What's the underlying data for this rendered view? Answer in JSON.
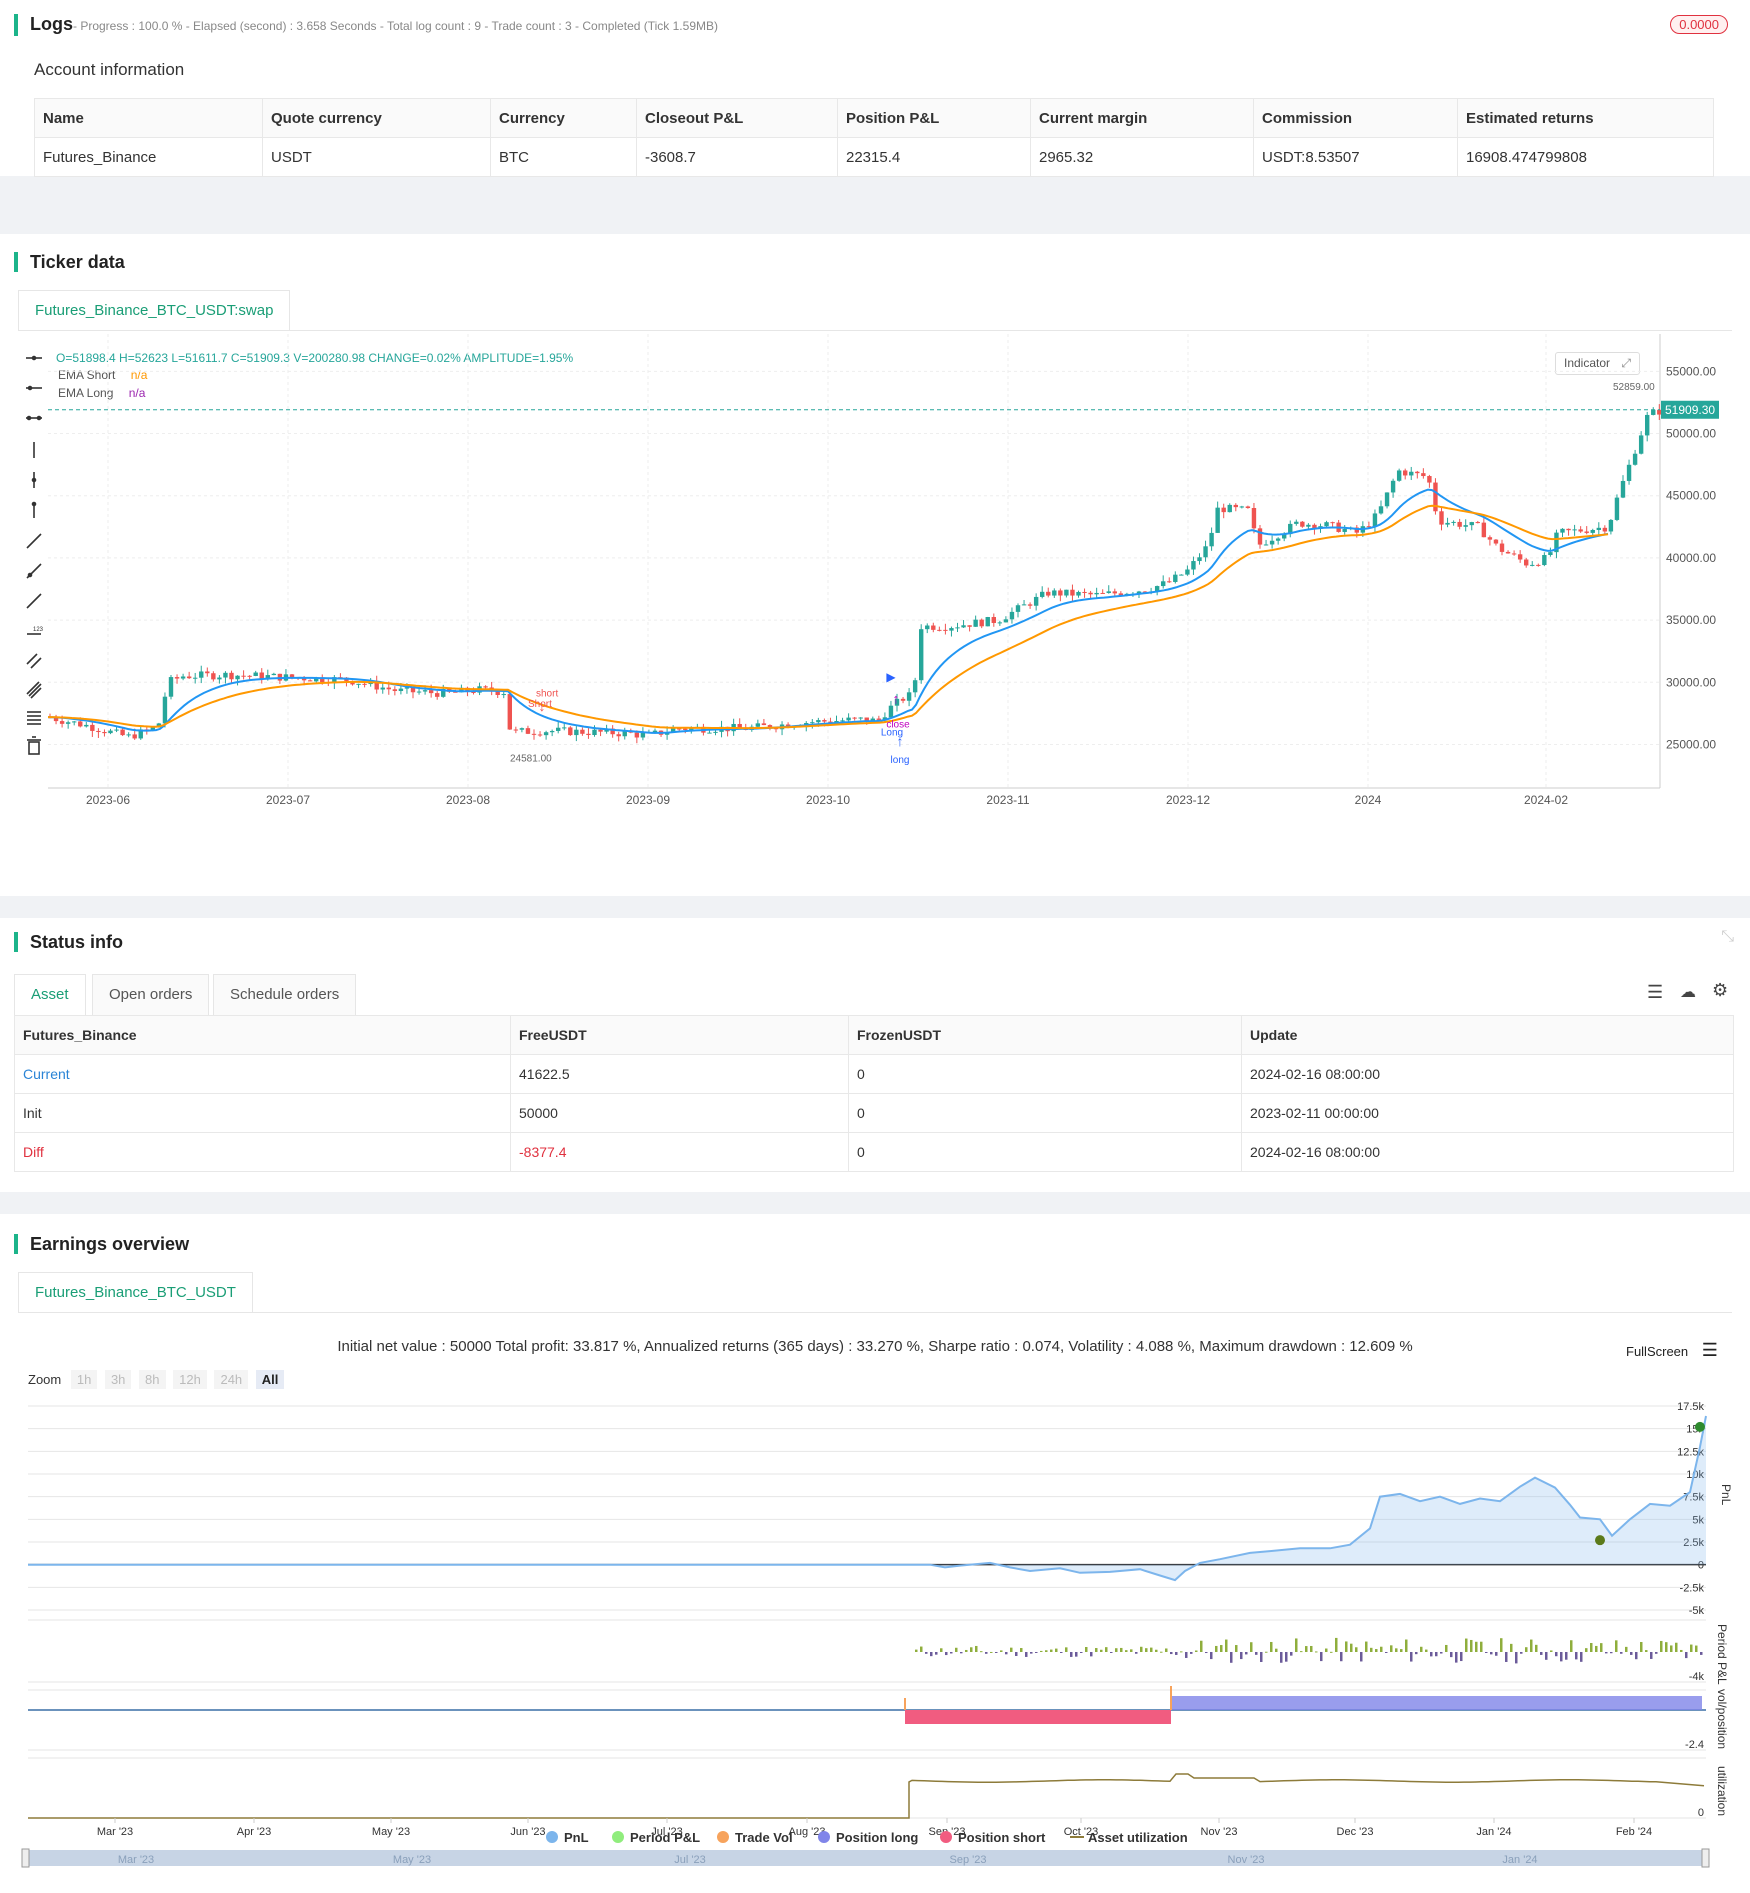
{
  "logs": {
    "title": "Logs",
    "progress_text": "- Progress : 100.0 % - Elapsed (second) : 3.658  Seconds - Total log count : 9 - Trade count : 3 - Completed (Tick 1.59MB)",
    "badge": "0.0000"
  },
  "account": {
    "title": "Account information",
    "headers": [
      "Name",
      "Quote currency",
      "Currency",
      "Closeout P&L",
      "Position P&L",
      "Current margin",
      "Commission",
      "Estimated returns"
    ],
    "row": [
      "Futures_Binance",
      "USDT",
      "BTC",
      "-3608.7",
      "22315.4",
      "2965.32",
      "USDT:8.53507",
      "16908.474799808"
    ]
  },
  "ticker": {
    "title": "Ticker data",
    "tab": "Futures_Binance_BTC_USDT:swap",
    "ohlc": "O=51898.4 H=52623 L=51611.7 C=51909.3 V=200280.98 CHANGE=0.02% AMPLITUDE=1.95%",
    "legend": [
      {
        "name": "EMA Short",
        "value": "n/a",
        "color": "#ff9800"
      },
      {
        "name": "EMA Long",
        "value": "n/a",
        "color": "#9c27b0"
      }
    ],
    "indicator_label": "Indicator",
    "last_price": "51909.30",
    "high_label": "52859.00",
    "low_label": "24581.00",
    "y_ticks": [
      "55000.00",
      "50000.00",
      "45000.00",
      "40000.00",
      "35000.00",
      "30000.00",
      "25000.00"
    ],
    "x_ticks": [
      "2023-06",
      "2023-07",
      "2023-08",
      "2023-09",
      "2023-10",
      "2023-11",
      "2023-12",
      "2024",
      "2024-02"
    ],
    "markers": {
      "short1": "short",
      "short2": "Short",
      "close": "close",
      "long1": "Long",
      "long2": "long"
    },
    "colors": {
      "up": "#26a69a",
      "down": "#ef5350",
      "ema_short": "#2196f3",
      "ema_long": "#ff9800"
    }
  },
  "status": {
    "title": "Status info",
    "tabs": [
      "Asset",
      "Open orders",
      "Schedule orders"
    ],
    "headers": [
      "Futures_Binance",
      "FreeUSDT",
      "FrozenUSDT",
      "Update"
    ],
    "rows": [
      [
        "Current",
        "41622.5",
        "0",
        "2024-02-16 08:00:00"
      ],
      [
        "Init",
        "50000",
        "0",
        "2023-02-11 00:00:00"
      ],
      [
        "Diff",
        "-8377.4",
        "0",
        "2024-02-16 08:00:00"
      ]
    ]
  },
  "earnings": {
    "title": "Earnings overview",
    "tab": "Futures_Binance_BTC_USDT",
    "summary": "Initial net value : 50000 Total profit: 33.817 %, Annualized returns (365 days) : 33.270 %, Sharpe ratio : 0.074, Volatility : 4.088 %, Maximum drawdown : 12.609 %",
    "fullscreen": "FullScreen",
    "zoom_label": "Zoom",
    "zoom_buttons": [
      "1h",
      "3h",
      "8h",
      "12h",
      "24h",
      "All"
    ],
    "pnl_ticks": [
      "17.5k",
      "15k",
      "12.5k",
      "10k",
      "7.5k",
      "5k",
      "2.5k",
      "0",
      "-2.5k",
      "-5k"
    ],
    "axis_names": [
      "PnL",
      "Period P&L",
      "vol/position",
      "utilization"
    ],
    "period_tick": "-4k",
    "pos_tick": "-2.4",
    "util_tick": "0",
    "x_ticks": [
      "Mar '23",
      "Apr '23",
      "May '23",
      "Jun '23",
      "Jul '23",
      "Aug '23",
      "Sep '23",
      "Oct '23",
      "Nov '23",
      "Dec '23",
      "Jan '24",
      "Feb '24"
    ],
    "nav_ticks": [
      "Mar '23",
      "May '23",
      "Jul '23",
      "Sep '23",
      "Nov '23",
      "Jan '24"
    ],
    "legend": [
      {
        "name": "PnL",
        "color": "#7cb5ec"
      },
      {
        "name": "Period P&L",
        "color": "#90ed7d"
      },
      {
        "name": "Trade Vol",
        "color": "#f7a35c"
      },
      {
        "name": "Position long",
        "color": "#8085e9"
      },
      {
        "name": "Position short",
        "color": "#f15c80"
      },
      {
        "name": "Asset utilization",
        "color": "#8d7b3a"
      }
    ]
  }
}
